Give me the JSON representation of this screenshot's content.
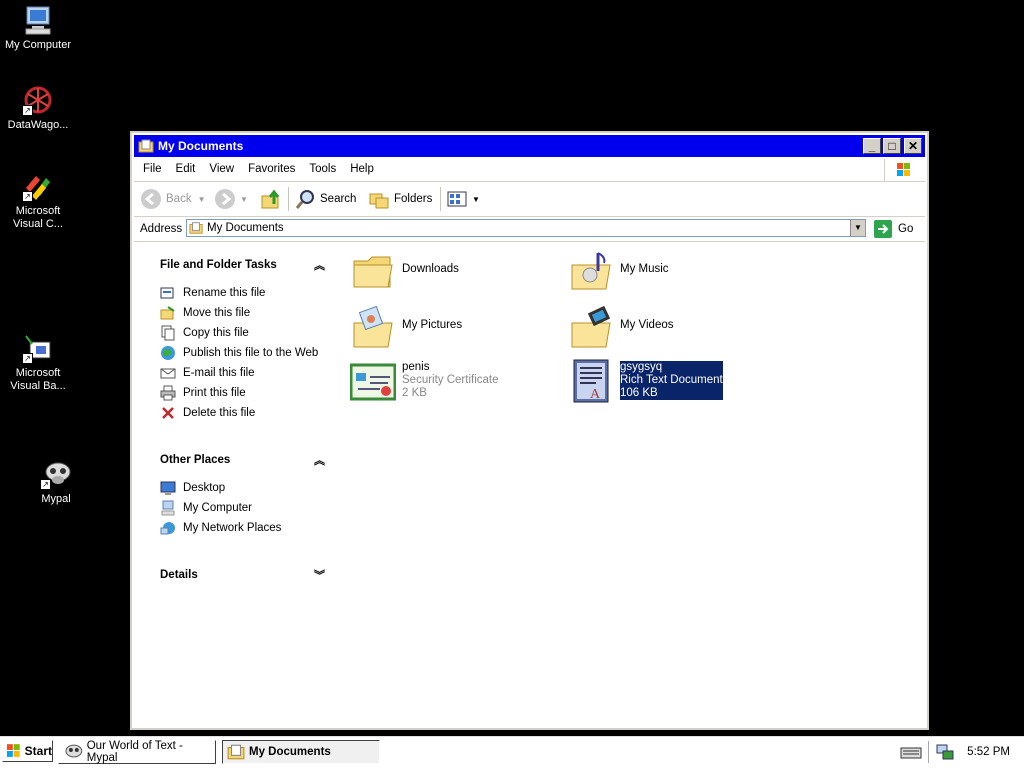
{
  "desktop": {
    "icons": [
      {
        "label": "My Computer",
        "icon": "my-computer-icon"
      },
      {
        "label": "DataWago...",
        "icon": "datawagon-icon"
      },
      {
        "label": "Microsoft Visual C...",
        "icon": "visual-c-icon"
      },
      {
        "label": "Microsoft Visual Ba...",
        "icon": "visual-basic-icon"
      },
      {
        "label": "Mypal",
        "icon": "mypal-icon"
      }
    ]
  },
  "window": {
    "title": "My Documents",
    "menu": [
      "File",
      "Edit",
      "View",
      "Favorites",
      "Tools",
      "Help"
    ],
    "toolbar": {
      "back": "Back",
      "search": "Search",
      "folders": "Folders"
    },
    "address": {
      "label": "Address",
      "value": "My Documents",
      "go": "Go"
    },
    "task_pane": {
      "file_tasks": {
        "title": "File and Folder Tasks",
        "items": [
          "Rename this file",
          "Move this file",
          "Copy this file",
          "Publish this file to the Web",
          "E-mail this file",
          "Print this file",
          "Delete this file"
        ]
      },
      "other_places": {
        "title": "Other Places",
        "items": [
          "Desktop",
          "My Computer",
          "My Network Places"
        ]
      },
      "details": {
        "title": "Details"
      }
    },
    "files": [
      {
        "name": "Downloads",
        "type": "",
        "size": "",
        "icon": "folder-icon"
      },
      {
        "name": "My Music",
        "type": "",
        "size": "",
        "icon": "music-folder-icon"
      },
      {
        "name": "My Pictures",
        "type": "",
        "size": "",
        "icon": "pictures-folder-icon"
      },
      {
        "name": "My Videos",
        "type": "",
        "size": "",
        "icon": "videos-folder-icon"
      },
      {
        "name": "penis",
        "type": "Security Certificate",
        "size": "2 KB",
        "icon": "certificate-icon"
      },
      {
        "name": "gsygsyq",
        "type": "Rich Text Document",
        "size": "106 KB",
        "icon": "rtf-document-icon",
        "selected": true
      }
    ]
  },
  "taskbar": {
    "start": "Start",
    "tasks": [
      "Our World of Text - Mypal",
      "My Documents"
    ],
    "clock": "5:52 PM"
  },
  "colors": {
    "titlebar": "#0000ee",
    "selection": "#0a246a"
  }
}
